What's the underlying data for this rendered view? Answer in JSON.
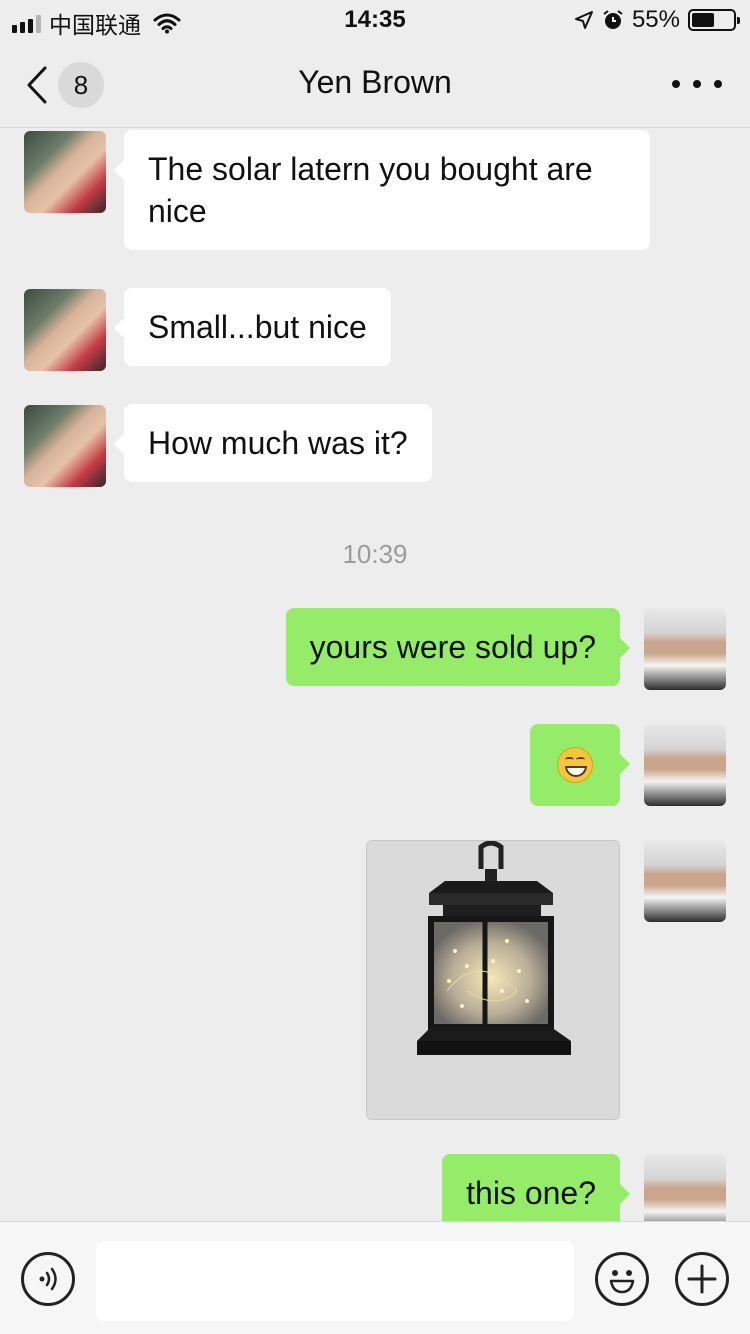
{
  "status_bar": {
    "carrier": "中国联通",
    "time": "14:35",
    "battery": "55%",
    "battery_level": 0.55,
    "icons": [
      "signal-icon",
      "wifi-icon",
      "location-icon",
      "alarm-icon",
      "battery-icon"
    ]
  },
  "nav": {
    "unread_count": "8",
    "title": "Yen Brown"
  },
  "messages": [
    {
      "direction": "in",
      "text": "The solar latern you bought are\n nice"
    },
    {
      "direction": "in",
      "text": "Small...but nice"
    },
    {
      "direction": "in",
      "text": "How much was it?"
    },
    {
      "type": "timestamp",
      "text": "10:39"
    },
    {
      "direction": "out",
      "text": "yours were sold up?"
    },
    {
      "direction": "out",
      "type": "emoji",
      "emoji": "grinning-face-icon"
    },
    {
      "direction": "out",
      "type": "image",
      "image": "solar-lantern-photo"
    },
    {
      "direction": "out",
      "text": "this one?"
    }
  ],
  "input_bar": {
    "value": "",
    "icons": [
      "voice-icon",
      "emoji-icon",
      "plus-icon"
    ]
  }
}
